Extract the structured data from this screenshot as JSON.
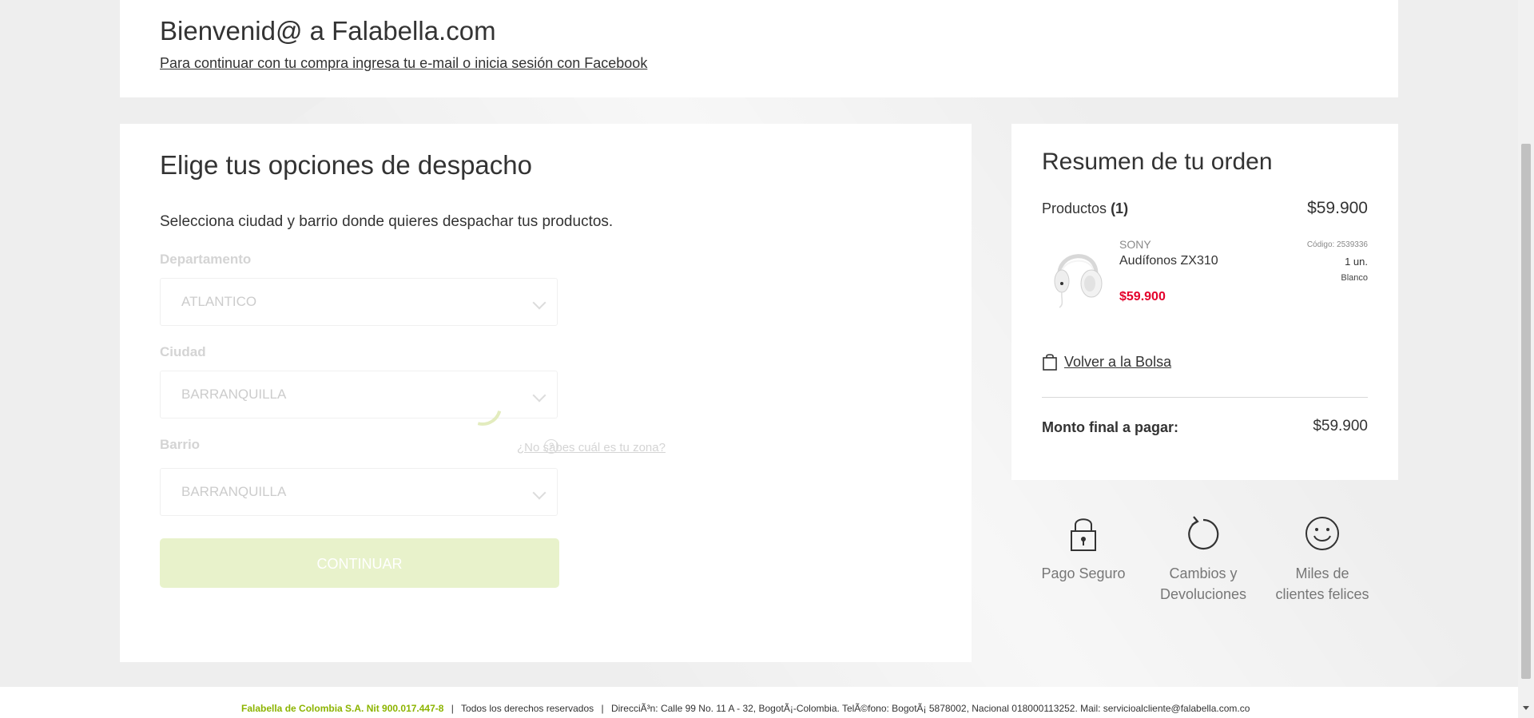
{
  "header": {
    "title": "Bienvenid@ a Falabella.com",
    "subtitle": "Para continuar con tu compra ingresa tu e-mail o inicia sesión con Facebook"
  },
  "dispatch": {
    "title": "Elige tus opciones de despacho",
    "description": "Selecciona ciudad y barrio donde quieres despachar tus productos.",
    "departamento": {
      "label": "Departamento",
      "value": "ATLANTICO"
    },
    "ciudad": {
      "label": "Ciudad",
      "value": "BARRANQUILLA"
    },
    "barrio": {
      "label": "Barrio",
      "value": "BARRANQUILLA"
    },
    "help_link": "¿No sabes cuál es tu zona?",
    "help_icon": "?",
    "continue_label": "CONTINUAR"
  },
  "summary": {
    "title": "Resumen de tu orden",
    "products_label": "Productos",
    "products_count": "(1)",
    "products_total": "$59.900",
    "product": {
      "brand": "SONY",
      "name": "Audífonos ZX310",
      "price": "$59.900",
      "code": "Código: 2539336",
      "qty": "1 un.",
      "color": "Blanco"
    },
    "back_to_bag": "Volver a la Bolsa",
    "total_label": "Monto final a pagar:",
    "total_amount": "$59.900"
  },
  "trust": {
    "secure": [
      "Pago Seguro"
    ],
    "returns": [
      "Cambios y",
      "Devoluciones"
    ],
    "happy": [
      "Miles de",
      "clientes felices"
    ]
  },
  "footer": {
    "company": "Falabella de Colombia S.A. Nit 900.017.447-8",
    "rights": "Todos los derechos reservados",
    "address": "DirecciÃ³n: Calle 99 No. 11 A - 32, BogotÃ¡-Colombia. TelÃ©fono: BogotÃ¡ 5878002, Nacional 018000113252. Mail: servicioalcliente@falabella.com.co",
    "separator": "|"
  },
  "colors": {
    "accent_green": "#8cb400",
    "price_red": "#e4002b",
    "button_disabled": "#e8f2cb"
  }
}
